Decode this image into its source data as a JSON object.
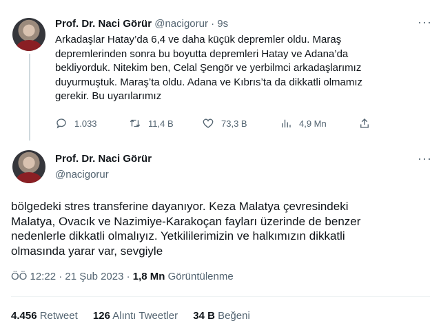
{
  "tweet1": {
    "author_name": "Prof. Dr. Naci Görür",
    "handle_time": "@nacigorur · 9s",
    "text": "Arkadaşlar Hatay’da 6,4 ve daha küçük depremler oldu. Maraş\ndepremlerinden sonra bu boyutta depremleri Hatay ve Adana’da\nbekliyorduk. Nitekim ben, Celal Şengör ve yerbilmci arkadaşlarımız\nduyurmuştuk. Maraş’ta oldu. Adana ve Kıbrıs’ta da dikkatli olmamız\ngerekir. Bu uyarılarımız",
    "more": "···",
    "replies": "1.033",
    "retweets": "11,4 B",
    "likes": "73,3 B",
    "views": "4,9 Mn"
  },
  "tweet2": {
    "author_name": "Prof. Dr. Naci Görür",
    "handle": "@nacigorur",
    "more": "···",
    "text": "bölgedeki stres transferine dayanıyor. Keza Malatya çevresindeki\nMalatya, Ovacık ve Nazimiye-Karakoçan fayları üzerinde de benzer\nnedenlerle dikkatli olmalıyız. Yetkililerimizin ve halkımızın dikkatli\nolmasında yarar var, sevgiyle",
    "timestamp": "ÖÖ 12:22 · 21 Şub 2023 · ",
    "view_count": "1,8 Mn",
    "view_label": " Görüntülenme",
    "stats": {
      "retweets_count": "4.456",
      "retweets_label": " Retweet",
      "quotes_count": "126",
      "quotes_label": " Alıntı Tweetler",
      "likes_count": "34 B",
      "likes_label": " Beğeni"
    }
  },
  "colors": {
    "text": "#0f1419",
    "muted": "#536471",
    "divider": "#eff3f4",
    "thread_line": "#cfd9de"
  }
}
